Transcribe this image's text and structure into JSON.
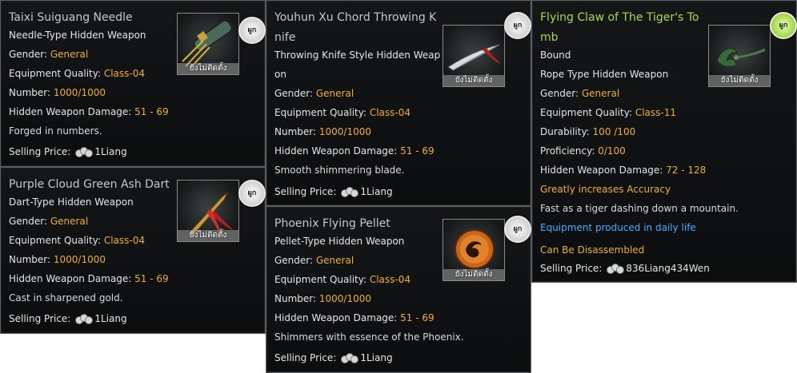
{
  "cards": [
    {
      "title": "Taixi Suiguang Needle",
      "type": "Needle-Type Hidden Weapon",
      "gender_label": "Gender: ",
      "gender": "General",
      "quality_label": "Equipment Quality: ",
      "quality": "Class-04",
      "number_label": "Number: ",
      "number": "1000/1000",
      "damage_label": "Hidden Weapon Damage: ",
      "damage": "51 - 69",
      "description": "Forged in numbers.",
      "price_label": "Selling Price:",
      "price": "1Liang",
      "icon_status": "ยังไม่ติดตั้ง",
      "badge": "ผูก"
    },
    {
      "title": "Purple Cloud Green Ash Dart",
      "type": "Dart-Type Hidden Weapon",
      "gender_label": "Gender: ",
      "gender": "General",
      "quality_label": "Equipment Quality: ",
      "quality": "Class-04",
      "number_label": "Number: ",
      "number": "1000/1000",
      "damage_label": "Hidden Weapon Damage: ",
      "damage": "51 - 69",
      "description": "Cast in sharpened gold.",
      "price_label": "Selling Price:",
      "price": "1Liang",
      "icon_status": "ยังไม่ติดตั้ง",
      "badge": "ผูก"
    },
    {
      "title": "Youhun Xu Chord Throwing K nife",
      "type": "Throwing Knife Style Hidden Weap on",
      "gender_label": "Gender: ",
      "gender": "General",
      "quality_label": "Equipment Quality: ",
      "quality": "Class-04",
      "number_label": "Number: ",
      "number": "1000/1000",
      "damage_label": "Hidden Weapon Damage: ",
      "damage": "51 - 69",
      "description": "Smooth shimmering blade.",
      "price_label": "Selling Price:",
      "price": "1Liang",
      "icon_status": "ยังไม่ติดตั้ง",
      "badge": "ผูก"
    },
    {
      "title": "Phoenix Flying Pellet",
      "type": "Pellet-Type Hidden Weapon",
      "gender_label": "Gender: ",
      "gender": "General",
      "quality_label": "Equipment Quality: ",
      "quality": "Class-04",
      "number_label": "Number: ",
      "number": "1000/1000",
      "damage_label": "Hidden Weapon Damage: ",
      "damage": "51 - 69",
      "description": "Shimmers with essence of the Phoenix.",
      "price_label": "Selling Price:",
      "price": "1Liang",
      "icon_status": "ยังไม่ติดตั้ง",
      "badge": "ผูก"
    },
    {
      "title": "Flying Claw of The Tiger's To mb",
      "bound": "Bound",
      "type": "Rope Type Hidden Weapon",
      "gender_label": "Gender: ",
      "gender": "General",
      "quality_label": "Equipment Quality: ",
      "quality": "Class-11",
      "durability_label": "Durability: ",
      "durability": "100 /100",
      "proficiency_label": "Proficiency: ",
      "proficiency": "0/100",
      "damage_label": "Hidden Weapon Damage: ",
      "damage": "72 - 128",
      "accuracy": "Greatly increases Accuracy",
      "description": "Fast as a tiger dashing down a mountain.",
      "produced": "Equipment produced in daily life",
      "disassemble": "Can Be Disassembled",
      "price_label": "Selling Price:",
      "price": "836Liang434Wen",
      "icon_status": "ยังไม่ติดตั้ง",
      "badge": "ผูก"
    }
  ],
  "colors": {
    "value": "#f0b022",
    "blue": "#3fb0ff",
    "green_title": "#a8d84a"
  }
}
